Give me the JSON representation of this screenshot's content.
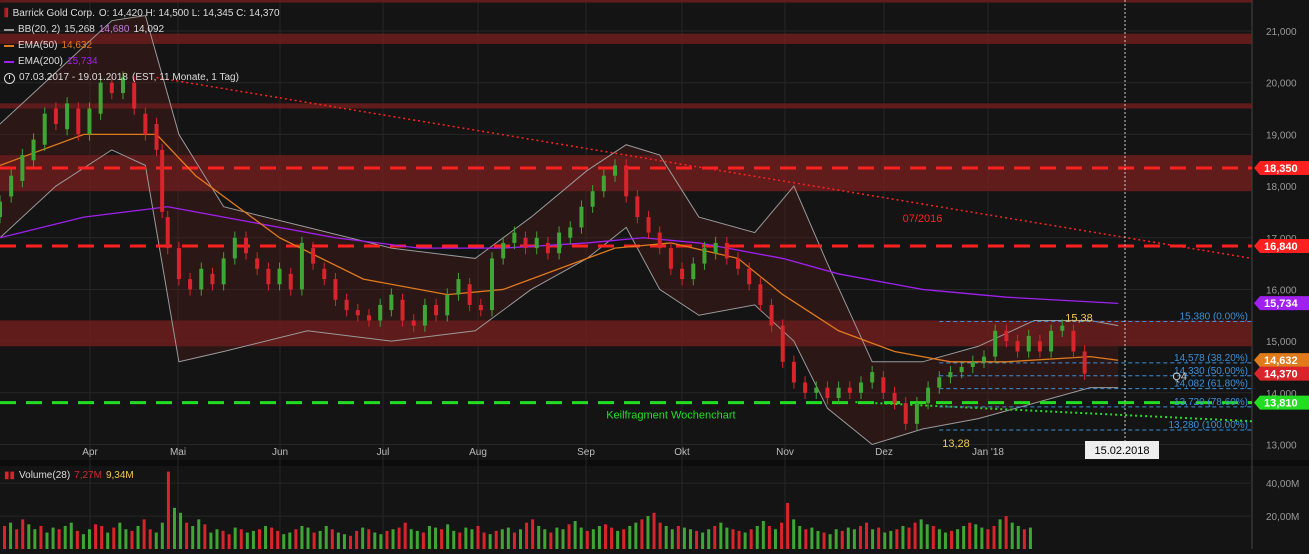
{
  "legend": {
    "symbol": "Barrick Gold Corp.",
    "ohlc": "O: 14,420  H: 14,500  L: 14,345  C: 14,370",
    "bb_label": "BB(20, 2)",
    "bb_values": [
      "15,268",
      "14,680",
      "14,092"
    ],
    "ema50_label": "EMA(50)",
    "ema50_value": "14,632",
    "ema200_label": "EMA(200)",
    "ema200_value": "15,734",
    "range": "07.03.2017 - 19.01.2018",
    "range_note": "(EST, 11 Monate, 1 Tag)"
  },
  "volume": {
    "label": "Volume(28)",
    "v1": "7,27M",
    "v2": "9,34M"
  },
  "colors": {
    "up": "#3fa535",
    "down": "#d9242b",
    "ema50": "#e07a1a",
    "ema200": "#a020f0",
    "bb": "#9a9a9a",
    "red_level": "#ff2020",
    "green_level": "#22dd22",
    "fib": "#3b8fd8"
  },
  "chart_data": {
    "type": "line",
    "title": "Barrick Gold Corp.",
    "y_ticks": [
      "21,000",
      "20,000",
      "19,000",
      "18,000",
      "17,000",
      "16,000",
      "15,000",
      "14,000",
      "13,000"
    ],
    "y_range": [
      12.7,
      21.6
    ],
    "x_ticks": [
      "Apr",
      "Mai",
      "Jun",
      "Jul",
      "Aug",
      "Sep",
      "Okt",
      "Nov",
      "Dez",
      "Jan '18"
    ],
    "x_range_days": [
      0,
      220
    ],
    "cursor_date": "15.02.2018",
    "close_points": [
      [
        0,
        17.7
      ],
      [
        3,
        18.3
      ],
      [
        6,
        18.9
      ],
      [
        9,
        19.5
      ],
      [
        12,
        19.4
      ],
      [
        15,
        19.2
      ],
      [
        18,
        19.8
      ],
      [
        21,
        19.9
      ],
      [
        24,
        19.7
      ],
      [
        27,
        19.2
      ],
      [
        30,
        17.0
      ],
      [
        33,
        16.1
      ],
      [
        36,
        15.9
      ],
      [
        39,
        16.2
      ],
      [
        42,
        16.6
      ],
      [
        45,
        17.0
      ],
      [
        48,
        16.6
      ],
      [
        51,
        16.3
      ],
      [
        54,
        16.0
      ],
      [
        57,
        16.7
      ],
      [
        60,
        16.4
      ],
      [
        63,
        15.9
      ],
      [
        66,
        15.6
      ],
      [
        69,
        15.4
      ],
      [
        72,
        15.6
      ],
      [
        75,
        15.3
      ],
      [
        78,
        15.4
      ],
      [
        81,
        15.8
      ],
      [
        84,
        16.0
      ],
      [
        87,
        15.8
      ],
      [
        90,
        16.9
      ],
      [
        93,
        17.0
      ],
      [
        96,
        16.8
      ],
      [
        99,
        16.9
      ],
      [
        102,
        17.0
      ],
      [
        105,
        17.5
      ],
      [
        108,
        17.9
      ],
      [
        111,
        18.1
      ],
      [
        114,
        18.2
      ],
      [
        117,
        17.8
      ],
      [
        120,
        17.0
      ],
      [
        123,
        16.5
      ],
      [
        126,
        16.2
      ],
      [
        129,
        16.4
      ],
      [
        132,
        16.7
      ],
      [
        135,
        16.9
      ],
      [
        138,
        16.6
      ],
      [
        141,
        16.1
      ],
      [
        144,
        16.0
      ],
      [
        147,
        14.5
      ],
      [
        150,
        14.1
      ],
      [
        153,
        14.0
      ],
      [
        156,
        14.0
      ],
      [
        159,
        14.0
      ],
      [
        162,
        14.2
      ],
      [
        165,
        14.1
      ],
      [
        168,
        13.8
      ],
      [
        171,
        13.5
      ],
      [
        173,
        13.7
      ],
      [
        175,
        14.0
      ],
      [
        178,
        14.2
      ],
      [
        181,
        14.4
      ],
      [
        184,
        14.5
      ],
      [
        187,
        14.6
      ],
      [
        190,
        14.6
      ],
      [
        193,
        15.2
      ],
      [
        196,
        15.1
      ],
      [
        199,
        15.0
      ],
      [
        202,
        15.3
      ],
      [
        205,
        14.9
      ],
      [
        207,
        14.6
      ],
      [
        208,
        14.37
      ]
    ],
    "candles": [
      [
        0,
        17.4,
        17.7
      ],
      [
        2,
        17.8,
        18.2
      ],
      [
        4,
        18.1,
        18.6
      ],
      [
        6,
        18.5,
        18.9
      ],
      [
        8,
        18.8,
        19.4
      ],
      [
        10,
        19.5,
        19.2
      ],
      [
        12,
        19.1,
        19.6
      ],
      [
        14,
        19.5,
        19.0
      ],
      [
        16,
        19.0,
        19.5
      ],
      [
        18,
        19.4,
        20.0
      ],
      [
        20,
        20.0,
        19.8
      ],
      [
        22,
        19.8,
        20.1
      ],
      [
        24,
        20.0,
        19.5
      ],
      [
        26,
        19.4,
        19.0
      ],
      [
        28,
        19.2,
        18.7
      ],
      [
        29,
        18.7,
        17.5
      ],
      [
        30,
        17.4,
        16.8
      ],
      [
        32,
        16.8,
        16.2
      ],
      [
        34,
        16.2,
        16.0
      ],
      [
        36,
        16.0,
        16.4
      ],
      [
        38,
        16.3,
        16.1
      ],
      [
        40,
        16.1,
        16.6
      ],
      [
        42,
        16.6,
        17.0
      ],
      [
        44,
        17.0,
        16.7
      ],
      [
        46,
        16.6,
        16.4
      ],
      [
        48,
        16.4,
        16.1
      ],
      [
        50,
        16.1,
        16.4
      ],
      [
        52,
        16.3,
        16.0
      ],
      [
        54,
        16.0,
        16.9
      ],
      [
        56,
        16.8,
        16.5
      ],
      [
        58,
        16.4,
        16.2
      ],
      [
        60,
        16.2,
        15.8
      ],
      [
        62,
        15.8,
        15.6
      ],
      [
        64,
        15.6,
        15.5
      ],
      [
        66,
        15.5,
        15.4
      ],
      [
        68,
        15.4,
        15.7
      ],
      [
        70,
        15.6,
        15.9
      ],
      [
        72,
        15.8,
        15.4
      ],
      [
        74,
        15.4,
        15.3
      ],
      [
        76,
        15.3,
        15.7
      ],
      [
        78,
        15.7,
        15.5
      ],
      [
        80,
        15.5,
        15.9
      ],
      [
        82,
        15.9,
        16.2
      ],
      [
        84,
        16.1,
        15.7
      ],
      [
        86,
        15.7,
        15.6
      ],
      [
        88,
        15.6,
        16.6
      ],
      [
        90,
        16.6,
        16.9
      ],
      [
        92,
        16.9,
        17.1
      ],
      [
        94,
        17.0,
        16.8
      ],
      [
        96,
        16.8,
        17.0
      ],
      [
        98,
        16.9,
        16.7
      ],
      [
        100,
        16.7,
        17.1
      ],
      [
        102,
        17.0,
        17.2
      ],
      [
        104,
        17.2,
        17.6
      ],
      [
        106,
        17.6,
        17.9
      ],
      [
        108,
        17.9,
        18.2
      ],
      [
        110,
        18.2,
        18.4
      ],
      [
        112,
        18.4,
        17.8
      ],
      [
        114,
        17.8,
        17.4
      ],
      [
        116,
        17.4,
        17.1
      ],
      [
        118,
        17.1,
        16.8
      ],
      [
        120,
        16.8,
        16.4
      ],
      [
        122,
        16.4,
        16.2
      ],
      [
        124,
        16.2,
        16.5
      ],
      [
        126,
        16.5,
        16.8
      ],
      [
        128,
        16.7,
        16.9
      ],
      [
        130,
        16.9,
        16.6
      ],
      [
        132,
        16.6,
        16.4
      ],
      [
        134,
        16.4,
        16.1
      ],
      [
        136,
        16.1,
        15.7
      ],
      [
        138,
        15.7,
        15.3
      ],
      [
        140,
        15.3,
        14.6
      ],
      [
        142,
        14.6,
        14.2
      ],
      [
        144,
        14.2,
        14.0
      ],
      [
        146,
        14.0,
        14.1
      ],
      [
        148,
        14.1,
        13.9
      ],
      [
        150,
        13.9,
        14.1
      ],
      [
        152,
        14.1,
        14.0
      ],
      [
        154,
        14.0,
        14.2
      ],
      [
        156,
        14.2,
        14.4
      ],
      [
        158,
        14.3,
        14.0
      ],
      [
        160,
        14.0,
        13.8
      ],
      [
        162,
        13.8,
        13.4
      ],
      [
        164,
        13.4,
        13.8
      ],
      [
        166,
        13.8,
        14.1
      ],
      [
        168,
        14.1,
        14.3
      ],
      [
        170,
        14.3,
        14.4
      ],
      [
        172,
        14.4,
        14.5
      ],
      [
        174,
        14.5,
        14.6
      ],
      [
        176,
        14.6,
        14.7
      ],
      [
        178,
        14.7,
        15.2
      ],
      [
        180,
        15.2,
        15.0
      ],
      [
        182,
        15.0,
        14.8
      ],
      [
        184,
        14.8,
        15.1
      ],
      [
        186,
        15.0,
        14.8
      ],
      [
        188,
        14.8,
        15.2
      ],
      [
        190,
        15.2,
        15.3
      ],
      [
        192,
        15.2,
        14.8
      ],
      [
        194,
        14.8,
        14.37
      ]
    ],
    "bb_upper": [
      [
        0,
        19.2
      ],
      [
        10,
        20.2
      ],
      [
        20,
        21.2
      ],
      [
        26,
        21.3
      ],
      [
        32,
        19.0
      ],
      [
        40,
        17.6
      ],
      [
        55,
        17.2
      ],
      [
        70,
        16.8
      ],
      [
        85,
        16.6
      ],
      [
        95,
        17.4
      ],
      [
        105,
        18.3
      ],
      [
        112,
        18.8
      ],
      [
        118,
        18.6
      ],
      [
        125,
        17.4
      ],
      [
        135,
        17.1
      ],
      [
        142,
        18.0
      ],
      [
        148,
        16.5
      ],
      [
        156,
        14.6
      ],
      [
        165,
        14.6
      ],
      [
        175,
        14.9
      ],
      [
        185,
        15.4
      ],
      [
        195,
        15.4
      ],
      [
        200,
        15.3
      ]
    ],
    "bb_lower": [
      [
        0,
        17.0
      ],
      [
        10,
        18.0
      ],
      [
        20,
        18.7
      ],
      [
        26,
        18.4
      ],
      [
        32,
        14.6
      ],
      [
        40,
        14.8
      ],
      [
        55,
        15.2
      ],
      [
        70,
        15.0
      ],
      [
        85,
        15.2
      ],
      [
        95,
        16.0
      ],
      [
        105,
        16.6
      ],
      [
        112,
        17.2
      ],
      [
        118,
        16.0
      ],
      [
        125,
        15.5
      ],
      [
        135,
        15.7
      ],
      [
        142,
        15.0
      ],
      [
        148,
        13.7
      ],
      [
        156,
        13.0
      ],
      [
        165,
        13.3
      ],
      [
        175,
        13.5
      ],
      [
        185,
        13.8
      ],
      [
        195,
        14.1
      ],
      [
        200,
        14.1
      ]
    ],
    "ema50": [
      [
        0,
        18.4
      ],
      [
        15,
        19.0
      ],
      [
        28,
        19.0
      ],
      [
        35,
        18.2
      ],
      [
        50,
        17.0
      ],
      [
        65,
        16.2
      ],
      [
        80,
        15.9
      ],
      [
        90,
        16.0
      ],
      [
        100,
        16.4
      ],
      [
        110,
        16.8
      ],
      [
        120,
        16.9
      ],
      [
        132,
        16.6
      ],
      [
        140,
        15.9
      ],
      [
        150,
        15.2
      ],
      [
        160,
        14.8
      ],
      [
        170,
        14.6
      ],
      [
        180,
        14.6
      ],
      [
        195,
        14.7
      ],
      [
        200,
        14.63
      ]
    ],
    "ema200": [
      [
        0,
        17.0
      ],
      [
        15,
        17.4
      ],
      [
        30,
        17.6
      ],
      [
        45,
        17.3
      ],
      [
        60,
        17.0
      ],
      [
        75,
        16.8
      ],
      [
        90,
        16.8
      ],
      [
        105,
        16.9
      ],
      [
        115,
        17.0
      ],
      [
        125,
        16.9
      ],
      [
        140,
        16.6
      ],
      [
        150,
        16.3
      ],
      [
        165,
        16.0
      ],
      [
        180,
        15.85
      ],
      [
        200,
        15.73
      ]
    ],
    "levels_red_dashed": [
      18.35,
      16.84
    ],
    "level_green_dashed": 13.81,
    "zones_red": [
      [
        21.55,
        21.65
      ],
      [
        20.75,
        20.95
      ],
      [
        19.5,
        19.6
      ],
      [
        17.9,
        18.6
      ],
      [
        14.9,
        15.4
      ]
    ],
    "price_tags": [
      {
        "label": "18,350",
        "value": 18.35,
        "color": "#ff2020"
      },
      {
        "label": "16,840",
        "value": 16.84,
        "color": "#ff2020"
      },
      {
        "label": "15,734",
        "value": 15.734,
        "color": "#a020f0"
      },
      {
        "label": "14,632",
        "value": 14.632,
        "color": "#e07a1a"
      },
      {
        "label": "14,370",
        "value": 14.37,
        "color": "#d9242b"
      },
      {
        "label": "13,810",
        "value": 13.81,
        "color": "#22dd22"
      }
    ],
    "fib_levels": [
      {
        "label": "15,380 (0.00%)",
        "value": 15.38
      },
      {
        "label": "14,578 (38.20%)",
        "value": 14.578
      },
      {
        "label": "14,330 (50.00%)",
        "value": 14.33
      },
      {
        "label": "14,082 (61.80%)",
        "value": 14.082
      },
      {
        "label": "13,729 (78.60%)",
        "value": 13.729
      },
      {
        "label": "13,280 (100.00%)",
        "value": 13.28
      }
    ],
    "annotations": [
      {
        "text": "15,38",
        "value": 15.38,
        "day": 193,
        "color": "#f2c94c"
      },
      {
        "text": "13,28",
        "value": 12.95,
        "day": 171,
        "color": "#f2c94c"
      },
      {
        "text": "07/2016",
        "value": 17.3,
        "day": 165,
        "color": "#ff2020"
      },
      {
        "text": "Q4",
        "value": 14.25,
        "day": 211,
        "color": "#cccccc"
      },
      {
        "text": "Keilfragment Wochenchart",
        "value": 13.5,
        "day": 120,
        "color": "#22dd22"
      }
    ],
    "volume_ticks": [
      "40,00M",
      "20,00M"
    ],
    "volume_range": [
      0,
      48
    ],
    "volume": [
      14,
      16,
      12,
      18,
      15,
      12,
      14,
      10,
      13,
      12,
      14,
      16,
      11,
      9,
      12,
      15,
      14,
      10,
      13,
      16,
      12,
      11,
      14,
      18,
      12,
      10,
      16,
      47,
      25,
      22,
      16,
      14,
      18,
      15,
      10,
      12,
      11,
      9,
      13,
      12,
      10,
      11,
      12,
      14,
      13,
      11,
      9,
      10,
      12,
      14,
      13,
      10,
      11,
      14,
      12,
      10,
      9,
      8,
      11,
      13,
      12,
      10,
      9,
      11,
      12,
      13,
      16,
      12,
      11,
      10,
      14,
      13,
      12,
      15,
      11,
      10,
      13,
      12,
      14,
      10,
      9,
      11,
      12,
      13,
      10,
      12,
      16,
      18,
      14,
      12,
      10,
      13,
      12,
      15,
      17,
      13,
      11,
      12,
      14,
      15,
      13,
      11,
      12,
      14,
      16,
      18,
      20,
      22,
      16,
      14,
      12,
      14,
      13,
      12,
      11,
      10,
      12,
      14,
      16,
      13,
      12,
      11,
      10,
      12,
      14,
      17,
      14,
      12,
      16,
      28,
      18,
      14,
      12,
      13,
      11,
      10,
      9,
      12,
      11,
      13,
      12,
      14,
      16,
      12,
      13,
      10,
      11,
      12,
      14,
      13,
      16,
      18,
      15,
      14,
      12,
      10,
      11,
      12,
      14,
      16,
      15,
      13,
      12,
      14,
      18,
      20,
      16,
      14,
      12,
      13
    ]
  }
}
